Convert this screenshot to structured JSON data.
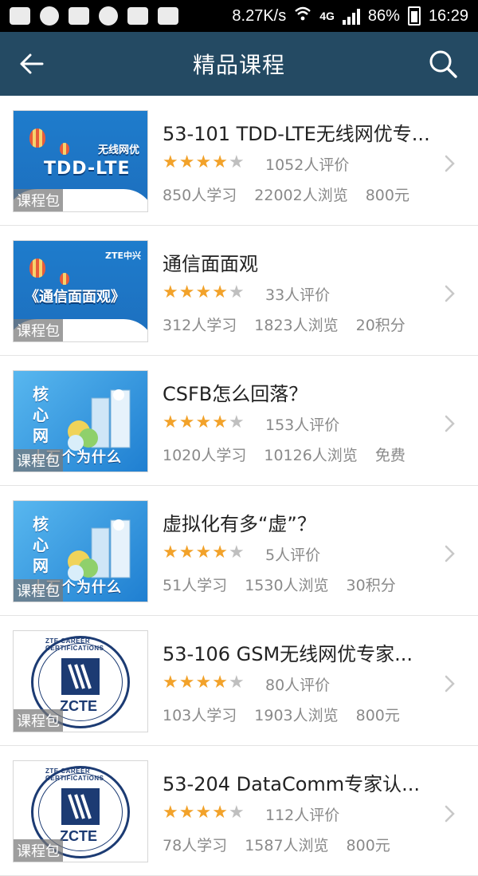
{
  "status_bar": {
    "net_speed": "8.27K/s",
    "network": "4G",
    "battery": "86%",
    "time": "16:29"
  },
  "header": {
    "title": "精品课程"
  },
  "courses": [
    {
      "title": "53-101 TDD-LTE无线网优专...",
      "rating_count": "1052人评价",
      "learners": "850人学习",
      "views": "22002人浏览",
      "price": "800元",
      "badge": "课程包",
      "art": "tdd",
      "art_text": "TDD-LTE",
      "art_sub": "无线网优",
      "stars": 4
    },
    {
      "title": "通信面面观",
      "rating_count": "33人评价",
      "learners": "312人学习",
      "views": "1823人浏览",
      "price": "20积分",
      "badge": "课程包",
      "art": "comm",
      "art_text": "《通信面面观》",
      "art_sub": "ZTE中兴",
      "stars": 4
    },
    {
      "title": "CSFB怎么回落？",
      "rating_count": "153人评价",
      "learners": "1020人学习",
      "views": "10126人浏览",
      "price": "免费",
      "badge": "课程包",
      "art": "core",
      "art_text": "核心网",
      "art_sub": "十万个为什么",
      "stars": 4
    },
    {
      "title": "虚拟化有多“虚”？",
      "rating_count": "5人评价",
      "learners": "51人学习",
      "views": "1530人浏览",
      "price": "30积分",
      "badge": "课程包",
      "art": "core",
      "art_text": "核心网",
      "art_sub": "十万个为什么",
      "stars": 4
    },
    {
      "title": "53-106 GSM无线网优专家...",
      "rating_count": "80人评价",
      "learners": "103人学习",
      "views": "1903人浏览",
      "price": "800元",
      "badge": "课程包",
      "art": "zcte",
      "art_text": "ZCTE",
      "art_sub": "ZTE CAREER CERTIFICATIONS",
      "stars": 4
    },
    {
      "title": "53-204 DataComm专家认...",
      "rating_count": "112人评价",
      "learners": "78人学习",
      "views": "1587人浏览",
      "price": "800元",
      "badge": "课程包",
      "art": "zcte",
      "art_text": "ZCTE",
      "art_sub": "ZTE CAREER CERTIFICATIONS",
      "stars": 4
    }
  ],
  "colors": {
    "header_bg": "#244a63",
    "star_on": "#f2a22a",
    "star_off": "#bfbfbf",
    "meta_text": "#8a8a8a"
  }
}
